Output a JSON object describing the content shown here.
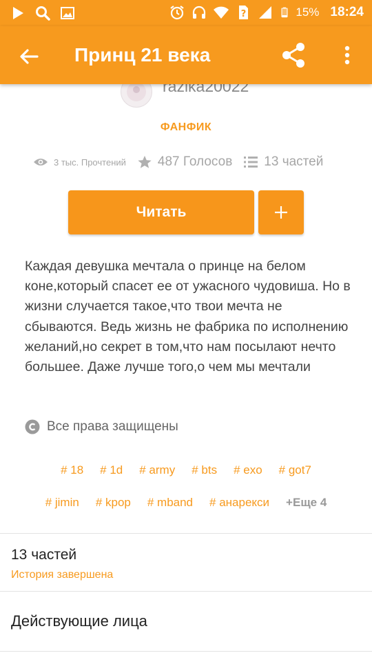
{
  "status_bar": {
    "battery": "15%",
    "time": "18:24",
    "left_icons": [
      "play-icon",
      "search-icon",
      "image-icon"
    ],
    "right_icons": [
      "alarm-icon",
      "headphones-icon",
      "wifi-icon",
      "sim-icon",
      "signal-icon",
      "battery-icon"
    ]
  },
  "app_bar": {
    "title": "Принц 21 века",
    "icons": [
      "back-arrow-icon",
      "share-icon",
      "more-vert-icon"
    ]
  },
  "author": {
    "name": "razika20022"
  },
  "category": "ФАНФИК",
  "stats": {
    "reads": "3 тыс. Прочтений",
    "votes": "487 Голосов",
    "parts": "13 частей"
  },
  "actions": {
    "read_label": "Читать",
    "add_label": "+"
  },
  "description": "Каждая девушка мечтала о принце на белом коне,который спасет ее от ужасного чудовиша. Но в жизни случается такое,что твои мечта не сбываются. Ведь жизнь не фабрика по исполнению желаний,но секрет в том,что нам посылают нечто большее. Даже лучше того,о чем мы мечтали",
  "rights": "Все права защищены",
  "tags_row1": [
    "# 18",
    "# 1d",
    "# army",
    "# bts",
    "# exo",
    "# got7"
  ],
  "tags_row2": [
    "# jimin",
    "# kpop",
    "# mband",
    "# анарекси"
  ],
  "more_tags": "+Еще 4",
  "parts_section": {
    "title": "13 частей",
    "status": "История завершена"
  },
  "cast_section": {
    "title": "Действующие лица"
  },
  "colors": {
    "accent": "#f79a1e",
    "button": "#f7961b",
    "muted": "#a6a6a6"
  }
}
